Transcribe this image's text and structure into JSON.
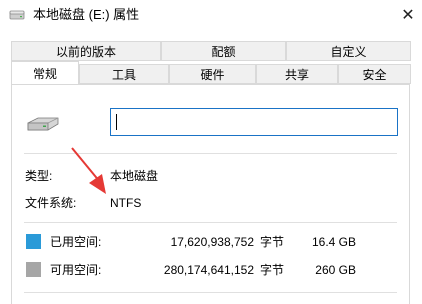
{
  "window": {
    "title": "本地磁盘 (E:) 属性",
    "close_glyph": "✕"
  },
  "tabs": {
    "row1": [
      "以前的版本",
      "配额",
      "自定义"
    ],
    "row2": [
      "常规",
      "工具",
      "硬件",
      "共享",
      "安全"
    ],
    "active": "常规"
  },
  "general": {
    "name_value": "",
    "type_label": "类型:",
    "type_value": "本地磁盘",
    "fs_label": "文件系统:",
    "fs_value": "NTFS",
    "used": {
      "label": "已用空间:",
      "bytes": "17,620,938,752",
      "unit": "字节",
      "size": "16.4 GB",
      "color": "#2a9ad8"
    },
    "free": {
      "label": "可用空间:",
      "bytes": "280,174,641,152",
      "unit": "字节",
      "size": "260 GB",
      "color": "#a6a6a6"
    }
  },
  "colors": {
    "arrow": "#e53935",
    "input_border": "#1a73c6"
  },
  "icons": {
    "title": "drive-icon",
    "drive": "hard-drive-icon",
    "close": "close-icon",
    "annotation": "red-arrow-annotation"
  }
}
